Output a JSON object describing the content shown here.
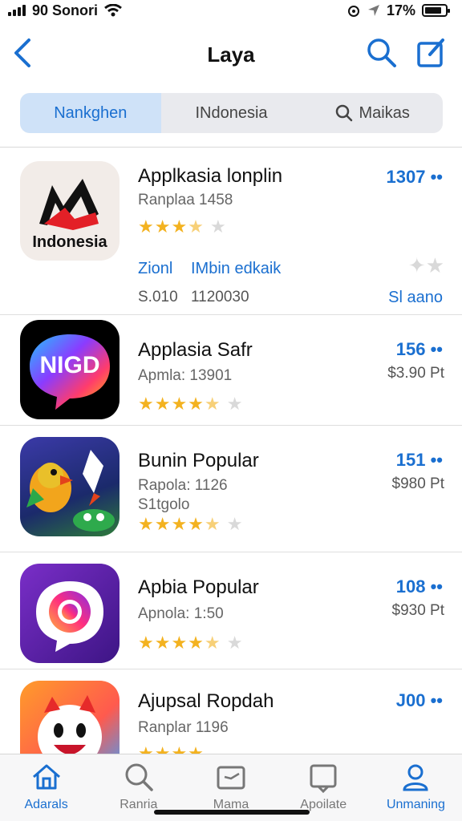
{
  "status_bar": {
    "carrier": "90 Sonori",
    "battery": "17%",
    "battery_level": 0.85
  },
  "nav": {
    "title": "Laya"
  },
  "segments": [
    {
      "label": "Nankghen",
      "active": true
    },
    {
      "label": "INdonesia",
      "active": false
    },
    {
      "label": "Maikas",
      "active": false
    }
  ],
  "apps": [
    {
      "name": "Applkasia lonplin",
      "sub": "Ranplaa 1458",
      "count": "1307 ••",
      "rating": 3.5,
      "icon_text": "Indonesia",
      "link_left": "Zionl",
      "link_right": "IMbin edkaik",
      "price_left": "S.010",
      "price_mid": "1120030",
      "link_bottom": "Sl aano"
    },
    {
      "name": "Applasia Safr",
      "sub": "Apmla: 13901",
      "count": "156 ••",
      "price": "$3.90 Pt",
      "rating": 4.5,
      "icon_text": "NIGD"
    },
    {
      "name": "Bunin Popular",
      "sub": "Rapola: 1126",
      "sub2": "S1tgolo",
      "count": "151 ••",
      "price": "$980 Pt",
      "rating": 4.5
    },
    {
      "name": "Apbia Popular",
      "sub": "Apnola: 1:50",
      "count": "108 ••",
      "price": "$930 Pt",
      "rating": 4.5
    },
    {
      "name": "Ajupsal Ropdah",
      "sub": "Ranplar 1196",
      "count": "J00 ••",
      "rating": 4.5
    }
  ],
  "tabs": [
    {
      "label": "Adarals",
      "icon": "home-icon",
      "active": true
    },
    {
      "label": "Ranria",
      "icon": "search-icon",
      "active": false
    },
    {
      "label": "Mama",
      "icon": "folder-icon",
      "active": false
    },
    {
      "label": "Apoilate",
      "icon": "tray-icon",
      "active": false
    },
    {
      "label": "Unmaning",
      "icon": "person-icon",
      "active": false
    }
  ],
  "colors": {
    "accent": "#1a6fd0",
    "star": "#f3b220",
    "segment_active": "#cfe2f8"
  }
}
